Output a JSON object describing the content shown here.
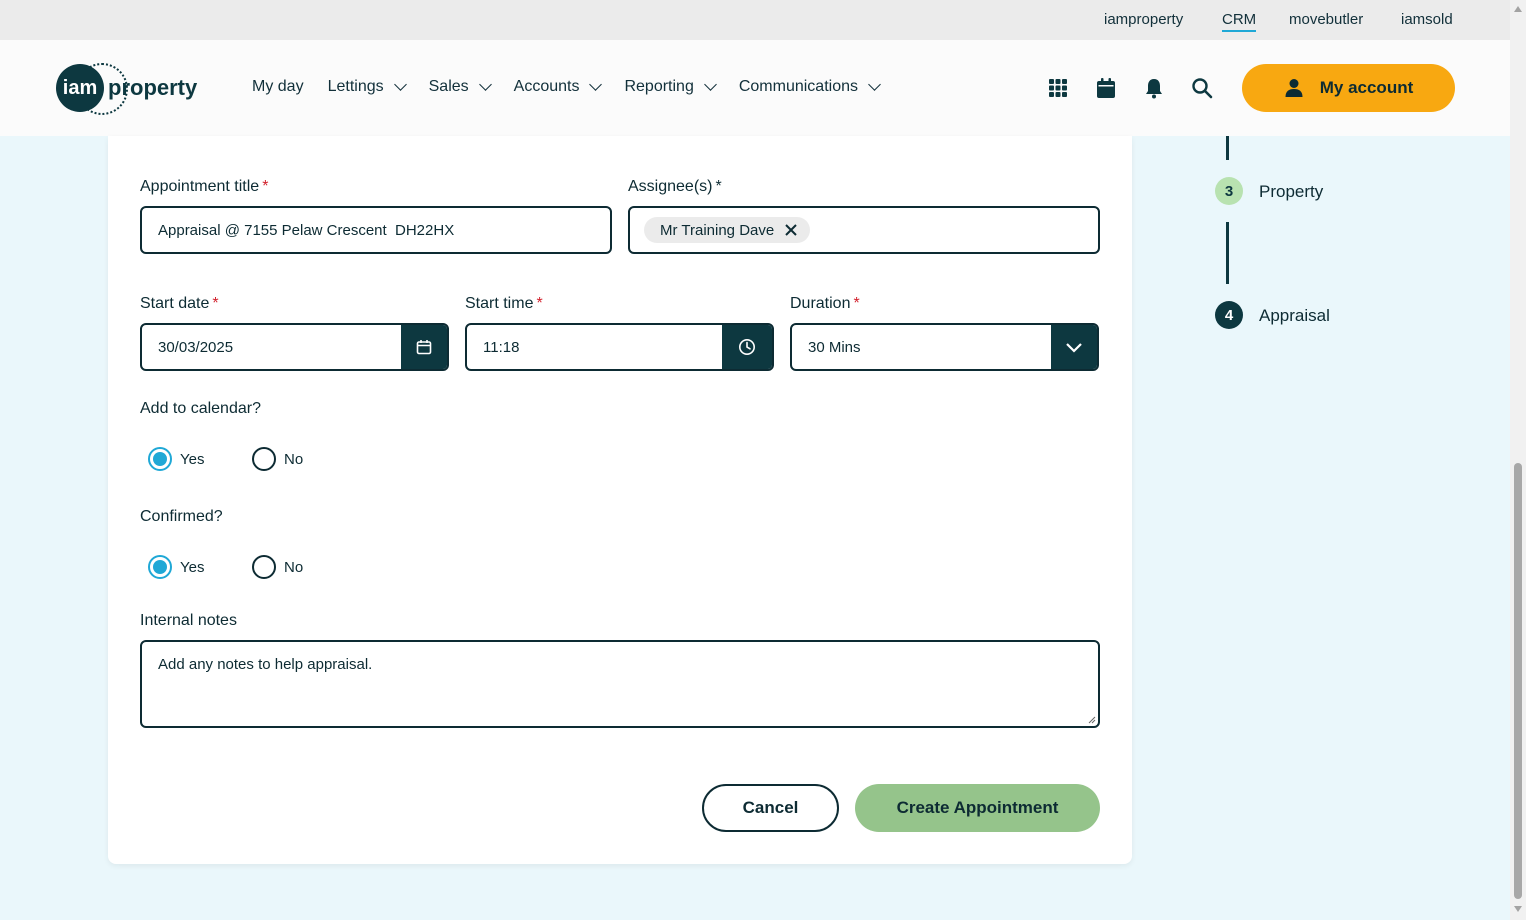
{
  "topbar": {
    "links": [
      "iamproperty",
      "CRM",
      "movebutler",
      "iamsold"
    ],
    "active": "CRM"
  },
  "header": {
    "logo_left": "iam",
    "logo_right": "property",
    "nav": [
      "My day",
      "Lettings",
      "Sales",
      "Accounts",
      "Reporting",
      "Communications"
    ],
    "icons": [
      "apps-grid-icon",
      "calendar-icon",
      "bell-icon",
      "search-icon"
    ],
    "account_label": "My account"
  },
  "form": {
    "title_label": "Appointment title",
    "title_value": "Appraisal @ 7155 Pelaw Crescent  DH22HX",
    "assignees_label": "Assignee(s)",
    "assignee_chip": "Mr Training Dave",
    "start_date_label": "Start date",
    "start_date_value": "30/03/2025",
    "start_time_label": "Start time",
    "start_time_value": "11:18",
    "duration_label": "Duration",
    "duration_value": "30 Mins",
    "calendar_question": "Add to calendar?",
    "calendar_yes": "Yes",
    "calendar_no": "No",
    "calendar_selected": "Yes",
    "confirmed_question": "Confirmed?",
    "confirmed_yes": "Yes",
    "confirmed_no": "No",
    "confirmed_selected": "Yes",
    "notes_label": "Internal notes",
    "notes_placeholder": "Add any notes to help appraisal.",
    "required_marker": "*",
    "cancel_label": "Cancel",
    "create_label": "Create Appointment"
  },
  "steps": [
    {
      "number": "3",
      "label": "Property",
      "state": "completed"
    },
    {
      "number": "4",
      "label": "Appraisal",
      "state": "current"
    }
  ],
  "colors": {
    "brand_dark": "#0d3840",
    "account_orange": "#f8a811",
    "accent_blue": "#1fa8d6",
    "create_green": "#95c48b",
    "step_done_green": "#b8e2b0",
    "page_bg": "#eaf7fb"
  }
}
